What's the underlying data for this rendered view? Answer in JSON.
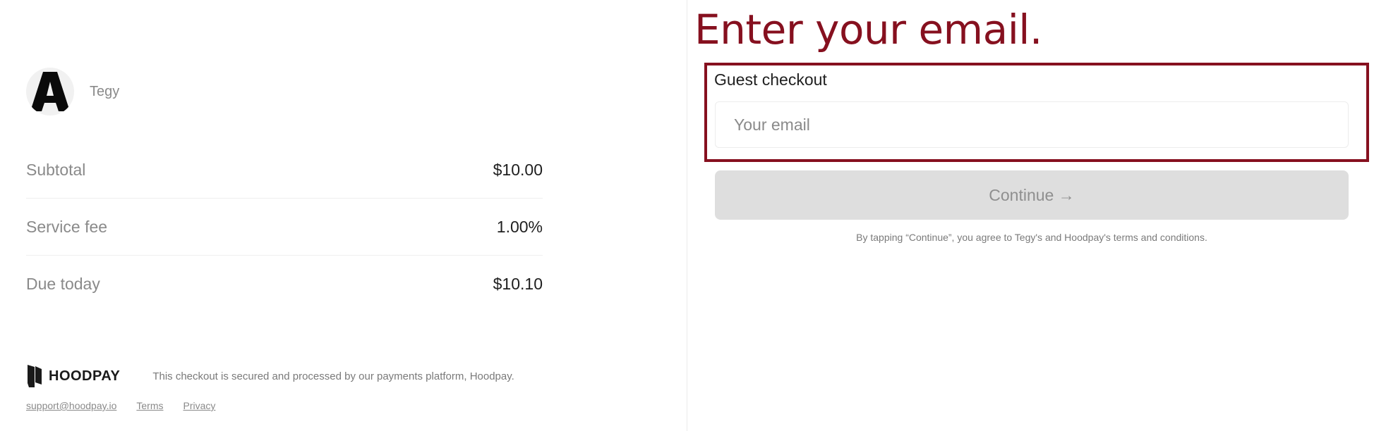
{
  "merchant": {
    "name": "Tegy",
    "avatar_letter": "A"
  },
  "summary": {
    "rows": [
      {
        "label": "Subtotal",
        "value": "$10.00"
      },
      {
        "label": "Service fee",
        "value": "1.00%"
      },
      {
        "label": "Due today",
        "value": "$10.10"
      }
    ]
  },
  "footer": {
    "brand": "HOODPAY",
    "secure_note": "This checkout is secured and processed by our payments platform, Hoodpay.",
    "links": {
      "support": "support@hoodpay.io",
      "terms": "Terms",
      "privacy": "Privacy"
    }
  },
  "checkout": {
    "annotation_title": "Enter your email.",
    "guest_label": "Guest checkout",
    "email_placeholder": "Your email",
    "email_value": "",
    "continue_label": "Continue →",
    "terms_note": "By tapping “Continue”, you agree to Tegy's and Hoodpay's terms and conditions."
  },
  "colors": {
    "accent": "#86101f",
    "muted_text": "#8a8a8a",
    "button_disabled_bg": "#dedede"
  },
  "icons": {
    "avatar": "letter-a-avatar",
    "brand": "hoodpay-logo-icon"
  }
}
